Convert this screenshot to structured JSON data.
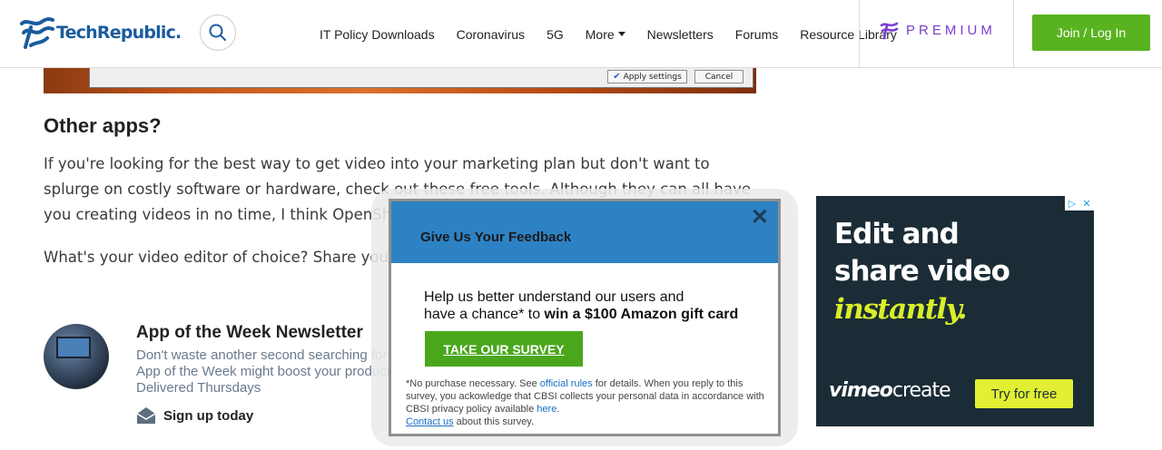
{
  "header": {
    "logo_text": "TechRepublic.",
    "nav": [
      "IT Policy Downloads",
      "Coronavirus",
      "5G",
      "More",
      "Newsletters",
      "Forums",
      "Resource Library"
    ],
    "premium_label": "PREMIUM",
    "join_label": "Join / Log In"
  },
  "image_dialog": {
    "apply_label": "Apply settings",
    "cancel_label": "Cancel"
  },
  "article": {
    "section_title": "Other apps?",
    "p1": "If you're looking for the best way to get video into your marketing plan but don't want to splurge on costly software or hardware, check out these free tools. Although they can all have you creating videos in no time, I think OpenShot is, w",
    "p2": "What's your video editor of choice? Share your t members."
  },
  "newsletter": {
    "title": "App of the Week Newsletter",
    "desc_1": "Don't waste another second searching for",
    "desc_2": "App of the Week might boost your product",
    "desc_3": "Delivered Thursdays",
    "signup_label": "Sign up today"
  },
  "ad": {
    "line1": "Edit and",
    "line2": "share video",
    "line3": "instantly.",
    "brand_prefix": "vimeo",
    "brand_suffix": "create",
    "cta": "Try for free",
    "colors": {
      "background": "#1b2c36",
      "accent": "#d9ee2a"
    }
  },
  "modal": {
    "title": "Give Us Your Feedback",
    "close_glyph": "✕",
    "body_line1": "Help us better understand our users and",
    "body_line2_prefix": "have a chance* to ",
    "body_line2_bold": "win a $100 Amazon gift card",
    "survey_label": "TAKE OUR SURVEY",
    "fine_1": "*No purchase necessary. See ",
    "fine_link_rules": "official rules",
    "fine_2": " for details. When you reply to this survey, you ackowledge that CBSI collects your personal data in accordance with CBSI privacy policy available ",
    "fine_link_here": "here",
    "fine_3": ".",
    "fine_link_contact": "Contact us",
    "fine_4": " about this survey.",
    "colors": {
      "header": "#2d82c4",
      "button": "#4aa71b"
    }
  },
  "colors": {
    "brand": "#1a5c9e",
    "join_button": "#59b31f",
    "premium": "#7a3fd0"
  }
}
